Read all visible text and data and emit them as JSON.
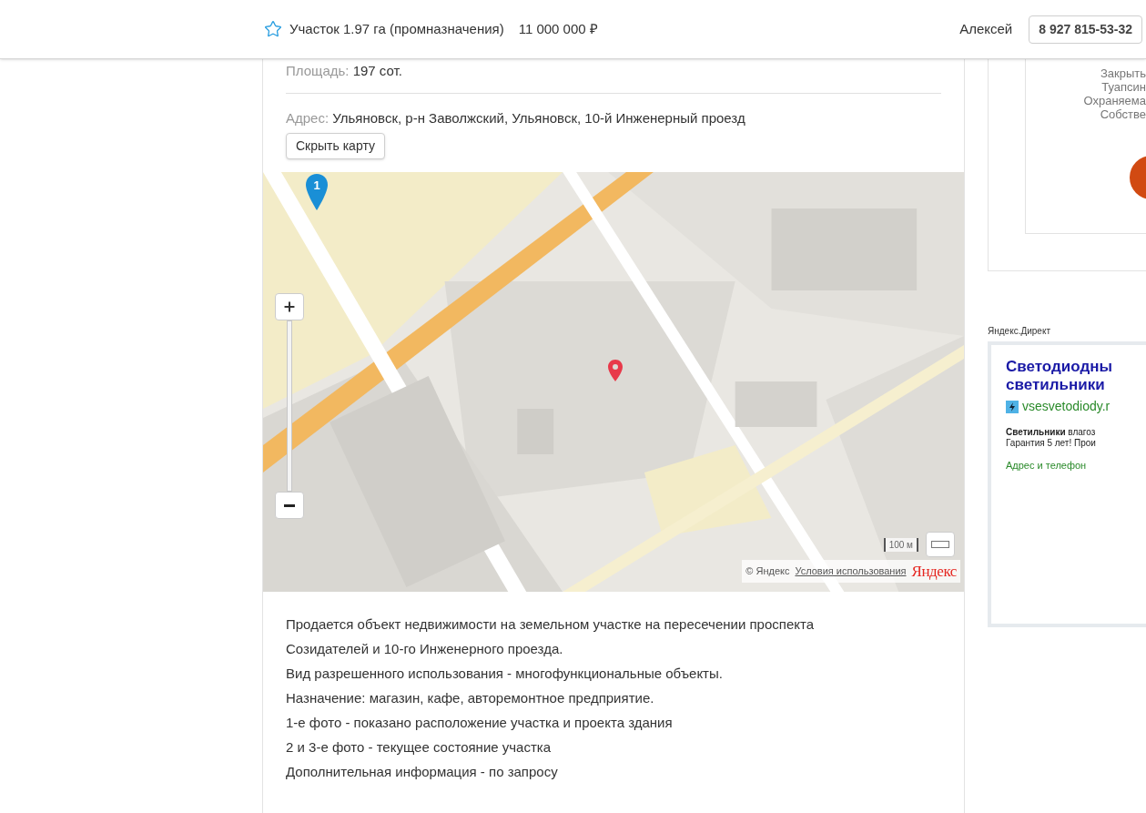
{
  "header": {
    "title": "Участок 1.97 га (промназначения)",
    "price": "11 000 000 ₽",
    "favorite": false,
    "seller": "Алексей",
    "phone": "8 927 815-53-32"
  },
  "listing": {
    "area_label": "Площадь:",
    "area_value": "197 сот.",
    "address_label": "Адрес:",
    "address": "Ульяновск, р-н Заволжский, Ульяновск, 10-й Инженерный проезд",
    "map_button": "Скрыть карту",
    "map": {
      "marker_label": "1",
      "scale": "100 м",
      "copyright": "© Яндекс",
      "terms_link": "Условия использования",
      "logo": "Яндекс"
    },
    "description": [
      "Продается объект недвижимости на земельном участке на пересечении проспекта Созидателей и 10-го Инженерного проезда.",
      "Вид разрешенного использования - многофункциональные объекты.",
      "Назначение: магазин, кафе, авторемонтное предприятие.",
      "1-е фото - показано расположение участка и проекта здания",
      "2 и 3-е фото - текущее состояние участка",
      "Дополнительная информация - по запросу"
    ]
  },
  "sidebar": {
    "promo_lines": [
      "Закрыть",
      "Туапсин",
      "Охраняема",
      "Собстве"
    ],
    "ad_label": "Яндекс.Директ",
    "ad": {
      "title_lines": [
        "Светодиодны",
        "светильники"
      ],
      "domain": "vsesvetodiody.r",
      "text_lines": [
        "**Светильники** влагоз",
        "Гарантия 5 лет! Прои"
      ],
      "link": "Адрес и телефон"
    }
  }
}
